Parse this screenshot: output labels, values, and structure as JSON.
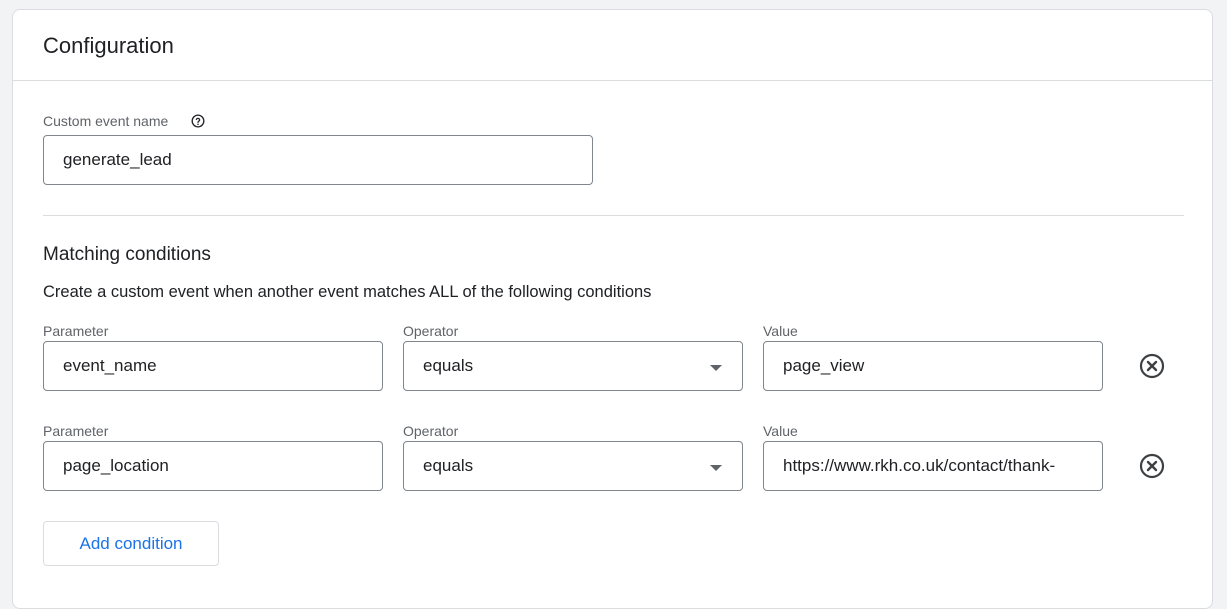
{
  "config": {
    "title": "Configuration"
  },
  "event_name": {
    "label": "Custom event name",
    "value": "generate_lead"
  },
  "matching": {
    "title": "Matching conditions",
    "description": "Create a custom event when another event matches ALL of the following conditions",
    "conditions": [
      {
        "parameter_label": "Parameter",
        "parameter_value": "event_name",
        "operator_label": "Operator",
        "operator_value": "equals",
        "value_label": "Value",
        "value_value": "page_view"
      },
      {
        "parameter_label": "Parameter",
        "parameter_value": "page_location",
        "operator_label": "Operator",
        "operator_value": "equals",
        "value_label": "Value",
        "value_value": "https://www.rkh.co.uk/contact/thank-"
      }
    ],
    "add_label": "Add condition"
  },
  "icons": {
    "help": "help-circle-icon",
    "remove": "close-circle-icon",
    "dropdown": "dropdown-arrow-icon"
  },
  "colors": {
    "accent": "#1a73e8",
    "border": "#80868b",
    "divider": "#dadce0"
  }
}
